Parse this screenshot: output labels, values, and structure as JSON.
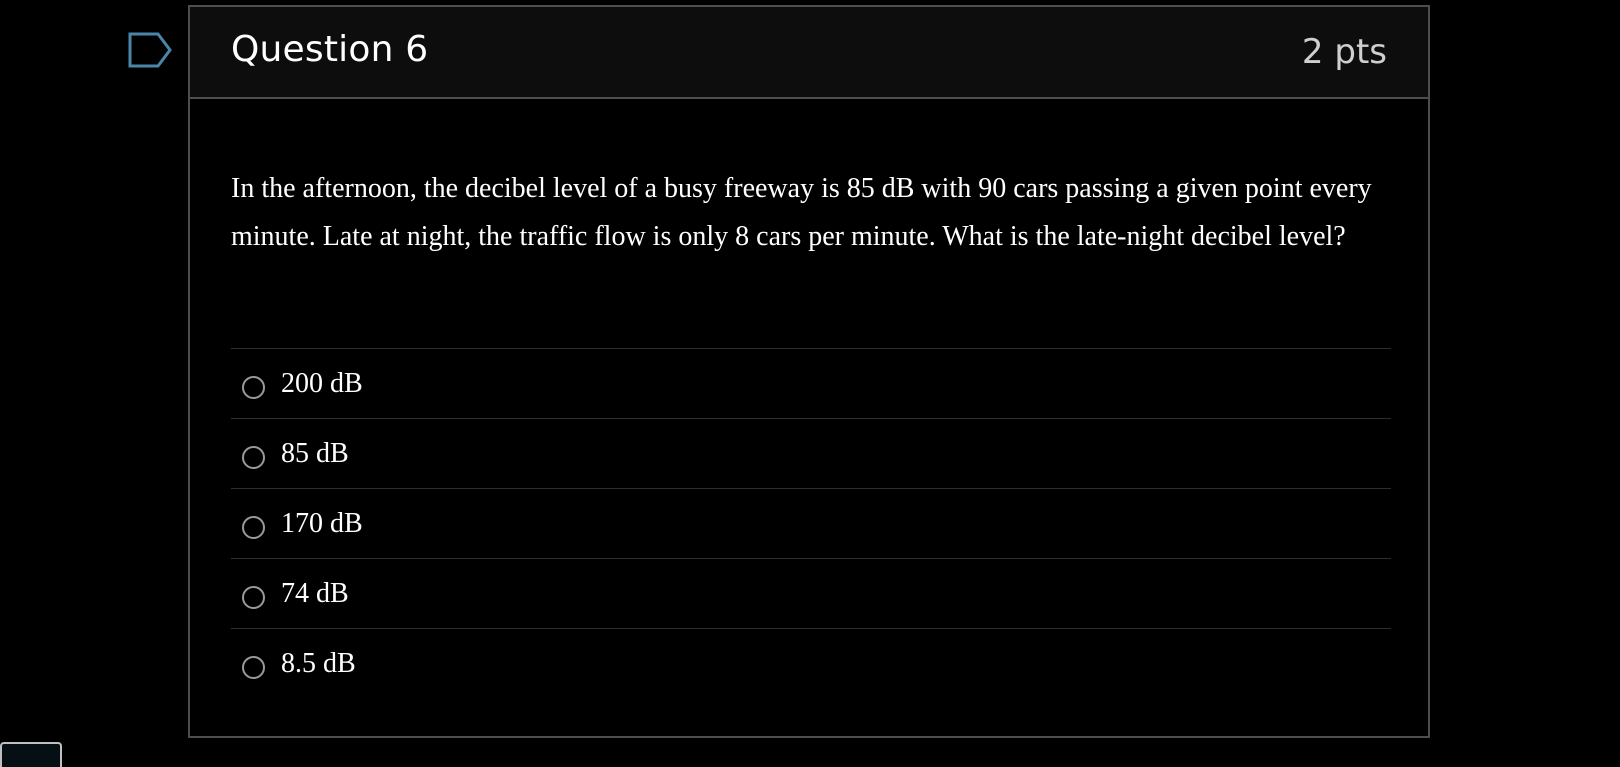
{
  "question": {
    "title": "Question 6",
    "points": "2 pts",
    "text": "In the afternoon, the decibel level of a busy freeway is 85 dB with 90 cars passing a given point every minute. Late at night, the traffic flow is only 8 cars per minute. What is the late-night decibel level?",
    "flag_icon": "flag-icon",
    "answers": [
      {
        "label": "200 dB",
        "selected": false
      },
      {
        "label": "85 dB",
        "selected": false
      },
      {
        "label": "170 dB",
        "selected": false
      },
      {
        "label": "74 dB",
        "selected": false
      },
      {
        "label": "8.5 dB",
        "selected": false
      }
    ]
  },
  "colors": {
    "background": "#000000",
    "header_background": "#0d0d0d",
    "border": "#4d4d4d",
    "flag_outline": "#4a86a8",
    "text": "#ffffff",
    "points_text": "#cfcfcf"
  }
}
